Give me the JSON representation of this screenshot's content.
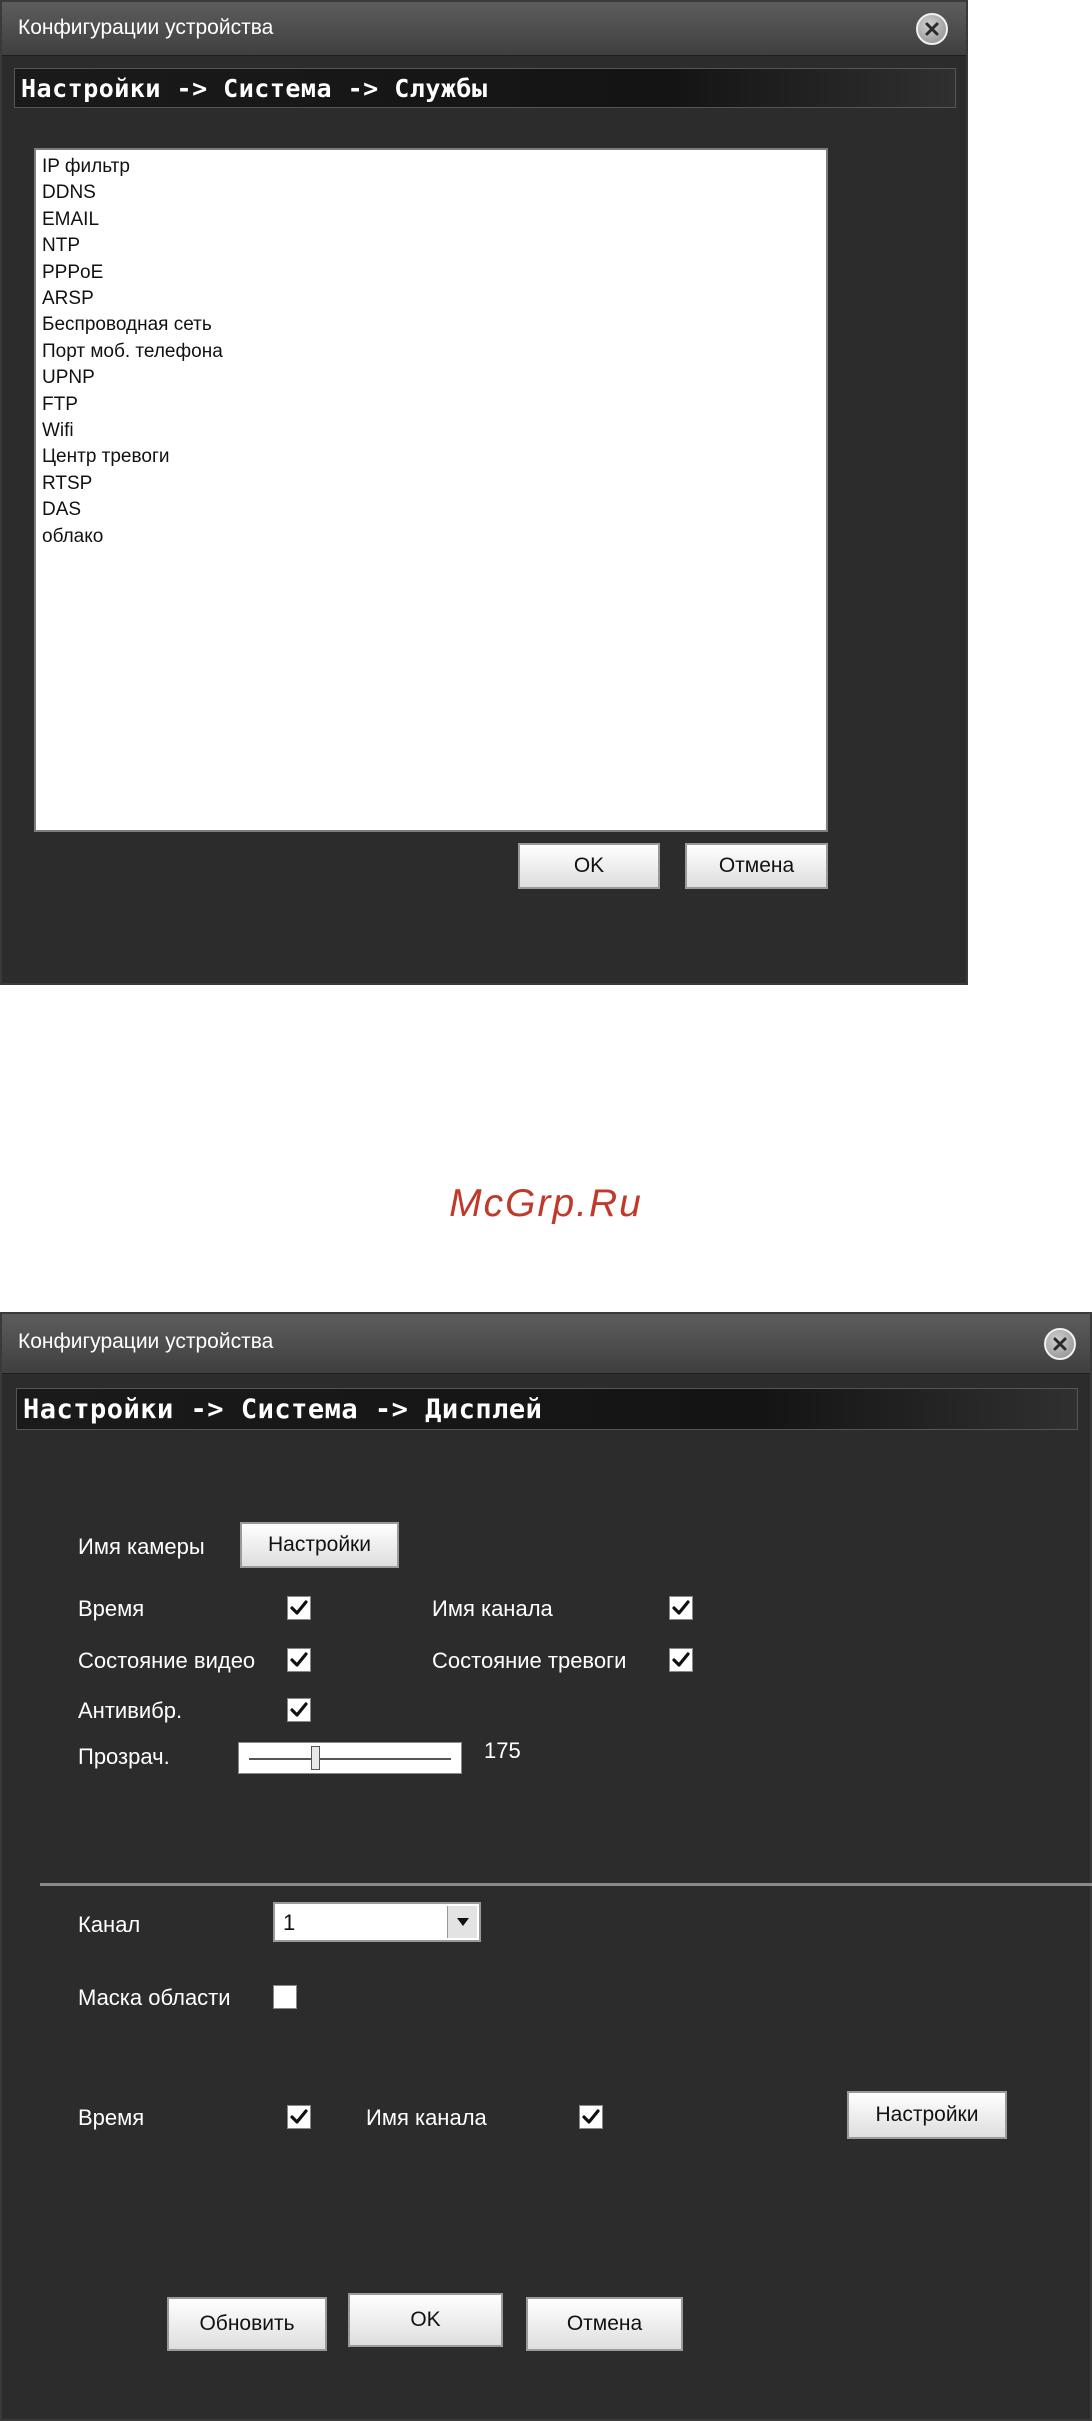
{
  "dialog1": {
    "title": "Конфигурации устройства",
    "breadcrumb": "Настройки -> Система -> Службы",
    "services": [
      "IP фильтр",
      "DDNS",
      "EMAIL",
      "NTP",
      "PPPoE",
      "ARSP",
      "Беспроводная сеть",
      "Порт моб. телефона",
      "UPNP",
      "FTP",
      "Wifi",
      "Центр тревоги",
      "RTSP",
      "DAS",
      "облако"
    ],
    "ok_label": "OK",
    "cancel_label": "Отмена"
  },
  "watermark": "McGrp.Ru",
  "dialog2": {
    "title": "Конфигурации устройства",
    "breadcrumb": "Настройки -> Система -> Дисплей",
    "camera_name_label": "Имя камеры",
    "settings_label": "Настройки",
    "time_label": "Время",
    "channel_name_label": "Имя канала",
    "video_status_label": "Состояние видео",
    "alarm_status_label": "Состояние тревоги",
    "antishake_label": "Антивибр.",
    "transparency_label": "Прозрач.",
    "transparency_value": "175",
    "transparency_level": 175,
    "transparency_max": 255,
    "channel_label": "Канал",
    "channel_value": "1",
    "mask_label": "Маска области",
    "time2_label": "Время",
    "channel_name2_label": "Имя канала",
    "settings2_label": "Настройки",
    "refresh_label": "Обновить",
    "ok_label": "OK",
    "cancel_label": "Отмена",
    "checks": {
      "time": true,
      "channel_name": true,
      "video_status": true,
      "alarm_status": true,
      "antishake": true,
      "region_mask": false,
      "time2": true,
      "channel_name2": true
    }
  }
}
